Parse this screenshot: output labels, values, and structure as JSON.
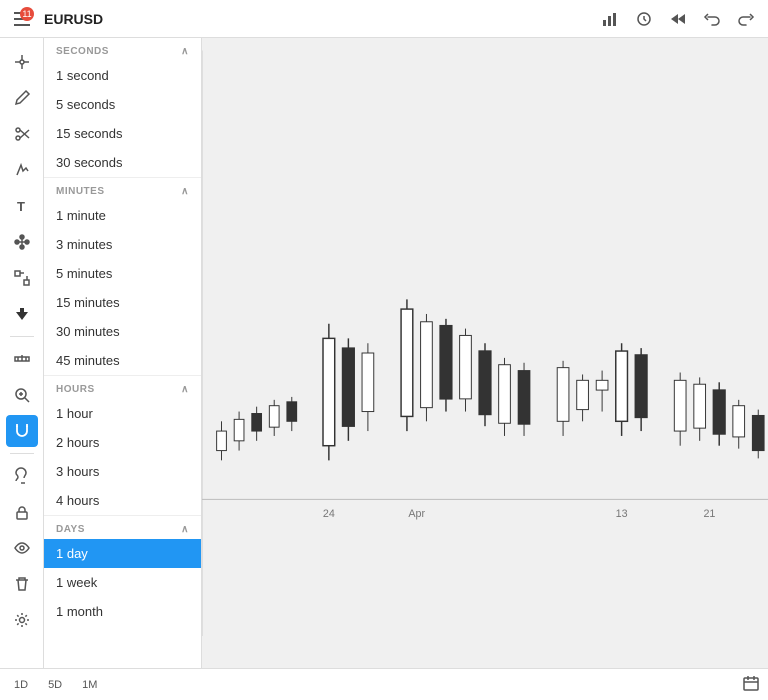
{
  "header": {
    "symbol": "EURUSD",
    "notification_count": "11"
  },
  "sidebar": {
    "icons": [
      {
        "name": "hamburger",
        "label": "≡",
        "active": false
      },
      {
        "name": "crosshair",
        "label": "+",
        "active": false
      },
      {
        "name": "pencil",
        "label": "✎",
        "active": false
      },
      {
        "name": "scissors",
        "label": "✂",
        "active": false
      },
      {
        "name": "pen",
        "label": "✏",
        "active": false
      },
      {
        "name": "text",
        "label": "T",
        "active": false
      },
      {
        "name": "node",
        "label": "⋮",
        "active": false
      },
      {
        "name": "connector",
        "label": "⊞",
        "active": false
      },
      {
        "name": "arrow-down",
        "label": "↓",
        "active": false
      },
      {
        "name": "measure",
        "label": "📏",
        "active": false
      },
      {
        "name": "zoom-in",
        "label": "⊕",
        "active": false
      },
      {
        "name": "magnet",
        "label": "🧲",
        "active": true
      },
      {
        "name": "paint",
        "label": "🖌",
        "active": false
      },
      {
        "name": "lock",
        "label": "🔒",
        "active": false
      },
      {
        "name": "eye",
        "label": "👁",
        "active": false
      },
      {
        "name": "trash",
        "label": "🗑",
        "active": false
      },
      {
        "name": "settings2",
        "label": "⚙",
        "active": false
      }
    ]
  },
  "dropdown": {
    "sections": [
      {
        "name": "SECONDS",
        "items": [
          "1 second",
          "5 seconds",
          "15 seconds",
          "30 seconds"
        ]
      },
      {
        "name": "MINUTES",
        "items": [
          "1 minute",
          "3 minutes",
          "5 minutes",
          "15 minutes",
          "30 minutes",
          "45 minutes"
        ]
      },
      {
        "name": "HOURS",
        "items": [
          "1 hour",
          "2 hours",
          "3 hours",
          "4 hours"
        ]
      },
      {
        "name": "DAYS",
        "items": [
          "1 day",
          "1 week",
          "1 month"
        ],
        "selected": "1 day"
      }
    ]
  },
  "chart": {
    "x_labels": [
      "24",
      "Apr",
      "13",
      "21"
    ],
    "date_labels": [
      "24",
      "Apr",
      "13",
      "21"
    ]
  },
  "bottom_bar": {
    "timeframes": [
      "1D",
      "5D",
      "1M"
    ],
    "icon_label": "⊡"
  },
  "header_icons": {
    "chart_type": "📊",
    "indicator": "⏱",
    "back": "⏮",
    "undo": "↩",
    "redo": "↪"
  }
}
